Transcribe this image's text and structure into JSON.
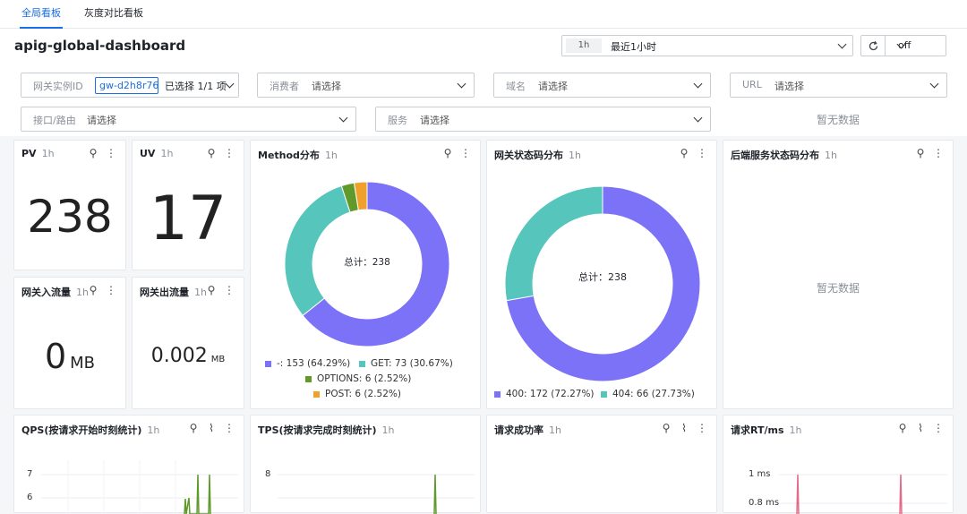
{
  "tabs": [
    {
      "label": "全局看板"
    },
    {
      "label": "灰度对比看板"
    }
  ],
  "header": {
    "title": "apig-global-dashboard",
    "range_badge": "1h",
    "range_text": "最近1小时",
    "refresh_value": "off"
  },
  "filters": {
    "gateway": {
      "label": "网关实例ID",
      "tag": "gw-d2h8r76",
      "summary": "已选择 1/1 项"
    },
    "consumer": {
      "label": "消费者",
      "placeholder": "请选择"
    },
    "domain": {
      "label": "域名",
      "placeholder": "请选择"
    },
    "url": {
      "label": "URL",
      "placeholder": "请选择"
    },
    "route": {
      "label": "接口/路由",
      "placeholder": "请选择"
    },
    "service": {
      "label": "服务",
      "placeholder": "请选择"
    },
    "empty_text": "暂无数据"
  },
  "cards": {
    "pv": {
      "title": "PV",
      "period": "1h",
      "value": "238"
    },
    "uv": {
      "title": "UV",
      "period": "1h",
      "value": "17"
    },
    "inflow": {
      "title": "网关入流量",
      "period": "1h",
      "value": "0",
      "unit": "MB"
    },
    "outflow": {
      "title": "网关出流量",
      "period": "1h",
      "value": "0.002",
      "unit": "MB"
    },
    "method": {
      "title": "Method分布",
      "period": "1h",
      "center": "总计：238",
      "legend": [
        "-: 153 (64.29%)",
        "GET: 73 (30.67%)",
        "OPTIONS: 6 (2.52%)",
        "POST: 6 (2.52%)"
      ]
    },
    "gw_status": {
      "title": "网关状态码分布",
      "period": "1h",
      "center": "总计：238",
      "legend": [
        "400: 172 (72.27%)",
        "404: 66 (27.73%)"
      ]
    },
    "backend_status": {
      "title": "后端服务状态码分布",
      "period": "1h",
      "empty": "暂无数据"
    },
    "qps": {
      "title": "QPS(按请求开始时刻统计)",
      "period": "1h",
      "ticks": [
        "7",
        "6"
      ]
    },
    "tps": {
      "title": "TPS(按请求完成时刻统计)",
      "period": "1h",
      "ticks": [
        "8"
      ]
    },
    "success": {
      "title": "请求成功率",
      "period": "1h"
    },
    "rt": {
      "title": "请求RT/ms",
      "period": "1h",
      "ticks": [
        "1 ms",
        "0.8 ms"
      ]
    }
  },
  "chart_data": [
    {
      "type": "pie",
      "title": "Method分布",
      "categories": [
        "-",
        "GET",
        "OPTIONS",
        "POST"
      ],
      "values": [
        153,
        73,
        6,
        6
      ],
      "colors": [
        "#7b72f7",
        "#56c5bb",
        "#5f9a2a",
        "#f0a12b"
      ]
    },
    {
      "type": "pie",
      "title": "网关状态码分布",
      "categories": [
        "400",
        "404"
      ],
      "values": [
        172,
        66
      ],
      "colors": [
        "#7b72f7",
        "#56c5bb"
      ]
    }
  ],
  "icons": {
    "card_pin": "pin-icon",
    "card_more": "more-icon",
    "card_chart": "line-chart-icon"
  }
}
